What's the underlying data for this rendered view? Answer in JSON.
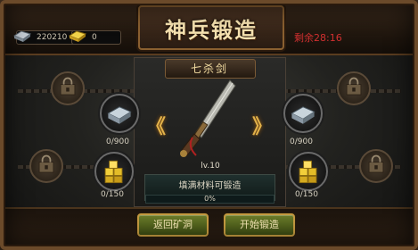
{
  "header": {
    "title": "神兵锻造",
    "timer": "剩余28:16"
  },
  "resources": {
    "silver": {
      "value": "220210",
      "icon": "silver-ingot-icon"
    },
    "gold": {
      "value": "0",
      "icon": "gold-ingot-icon"
    }
  },
  "weapon": {
    "name": "七杀剑",
    "level": "lv.10",
    "hint": "填满材料可锻造",
    "progress_text": "0%",
    "progress": 0
  },
  "materials": {
    "left_top": {
      "count": "0/900",
      "icon": "silver-ore-icon"
    },
    "left_bottom": {
      "count": "0/150",
      "icon": "gold-ore-icon"
    },
    "right_top": {
      "count": "0/900",
      "icon": "silver-ore-icon"
    },
    "right_bottom": {
      "count": "0/150",
      "icon": "gold-ore-icon"
    }
  },
  "nav": {
    "prev": "《",
    "next": "》"
  },
  "buttons": {
    "back": "返回矿洞",
    "start": "开始锻造"
  },
  "colors": {
    "timer": "#d23030",
    "title": "#f6e2b0",
    "button": "#5a6e1e",
    "button_border": "#c49a40"
  }
}
